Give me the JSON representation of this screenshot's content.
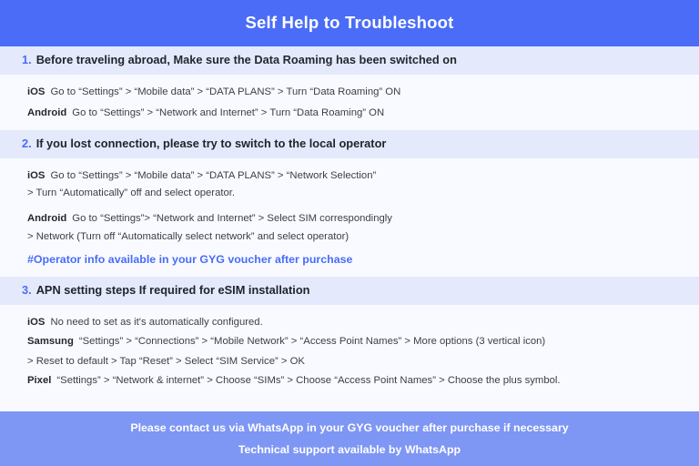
{
  "header": {
    "title": "Self Help to Troubleshoot"
  },
  "colors": {
    "header_blue": "#4a6cf7",
    "band_blue": "#e4eafc",
    "page_bg": "#f8faff",
    "footer_blue": "#7e96f4",
    "accent_text": "#4a6cf7",
    "body_text": "#3a3f47"
  },
  "sections": [
    {
      "number": "1.",
      "title_lead": "Before traveling abroad,",
      "title_rest": " Make sure the Data Roaming has been switched on",
      "rows": [
        {
          "platform": "iOS",
          "text": "Go to “Settings” > “Mobile data” > “DATA PLANS” > Turn “Data Roaming” ON"
        },
        {
          "platform": "Android",
          "text": "Go to “Settings” > “Network and Internet” > Turn “Data Roaming” ON"
        }
      ]
    },
    {
      "number": "2.",
      "title_lead": "If you lost connection, please try to switch to the local operator",
      "title_rest": "",
      "groups": [
        {
          "platform": "iOS",
          "line1": "Go to “Settings” > “Mobile data” > “DATA PLANS” > “Network Selection”",
          "line2": "> Turn “Automatically” off and select operator."
        },
        {
          "platform": "Android",
          "line1": "Go to “Settings”>  “Network and Internet” > Select SIM correspondingly",
          "line2": "> Network (Turn off “Automatically select network” and select operator)"
        }
      ],
      "note": "#Operator info available in your GYG voucher after purchase"
    },
    {
      "number": "3.",
      "title_lead": "APN setting steps If required for eSIM installation",
      "title_rest": "",
      "rows": [
        {
          "platform": "iOS",
          "text": "No need to set as it's automatically configured."
        },
        {
          "platform": "Samsung",
          "text": "“Settings” > “Connections” > “Mobile Network” > “Access Point Names” > More options (3 vertical icon)"
        },
        {
          "platform": "",
          "text": "> Reset to default > Tap “Reset” > Select “SIM Service” > OK"
        },
        {
          "platform": "Pixel",
          "text": "“Settings” > “Network & internet” > Choose “SIMs” > Choose “Access Point Names” > Choose the plus symbol."
        }
      ]
    }
  ],
  "footer": {
    "line1": "Please contact us via WhatsApp  in your GYG voucher after purchase if necessary",
    "line2": "Technical support available by WhatsApp"
  }
}
